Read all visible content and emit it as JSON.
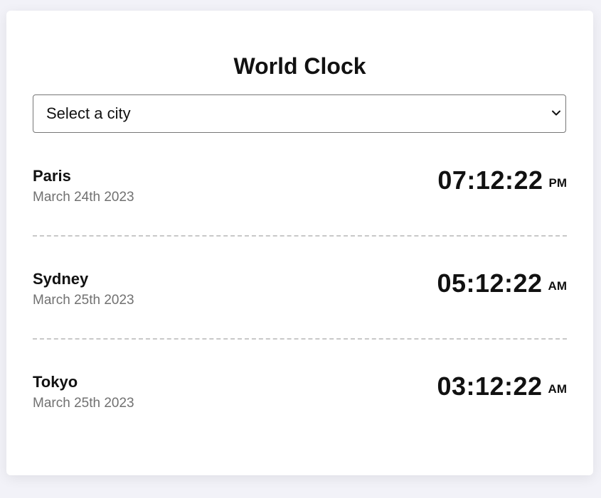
{
  "header": {
    "title": "World Clock"
  },
  "city_select": {
    "selected_label": "Select a city"
  },
  "cities": [
    {
      "name": "Paris",
      "date": "March 24th 2023",
      "time": "07:12:22",
      "meridiem": "PM"
    },
    {
      "name": "Sydney",
      "date": "March 25th 2023",
      "time": "05:12:22",
      "meridiem": "AM"
    },
    {
      "name": "Tokyo",
      "date": "March 25th 2023",
      "time": "03:12:22",
      "meridiem": "AM"
    }
  ],
  "icons": {
    "select": "chevron-down-icon"
  },
  "colors": {
    "background": "#f2f2f8",
    "card": "#ffffff",
    "text": "#111111",
    "date_text": "#717171",
    "divider": "#c8c8c8"
  }
}
